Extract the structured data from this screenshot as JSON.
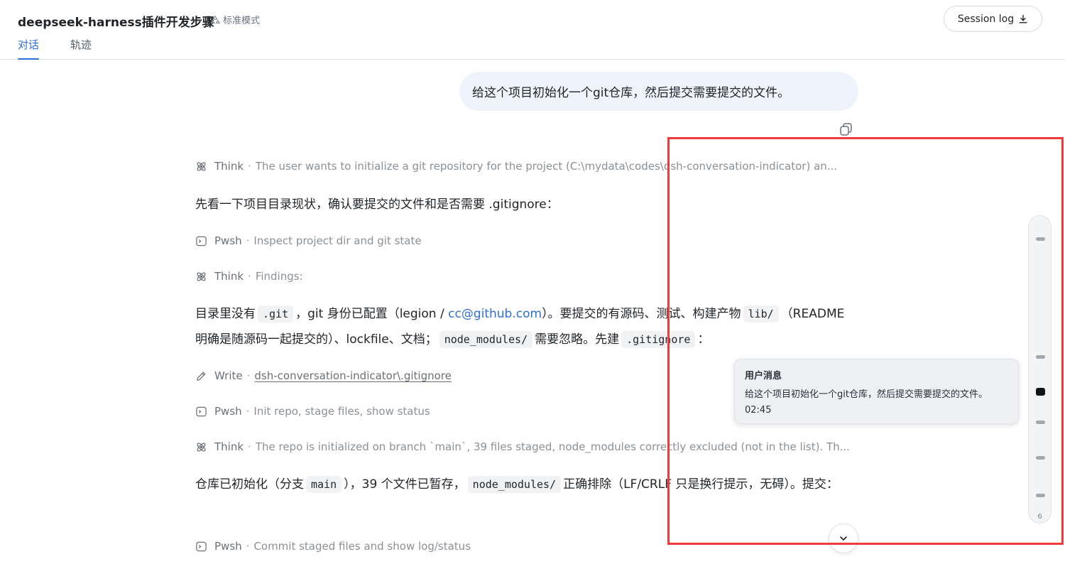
{
  "header": {
    "title": "deepseek-harness插件开发步骤",
    "mode_label": "标准模式",
    "tabs": [
      {
        "label": "对话",
        "active": true
      },
      {
        "label": "轨迹",
        "active": false
      }
    ],
    "session_log_label": "Session log"
  },
  "user_message": {
    "text": "给这个项目初始化一个git仓库，然后提交需要提交的文件。"
  },
  "steps": [
    {
      "kind": "Think",
      "icon": "atom-icon",
      "desc": "The user wants to initialize a git repository for the project (C:\\mydata\\codes\\dsh-conversation-indicator) an..."
    },
    {
      "kind": "Pwsh",
      "icon": "terminal-icon",
      "desc": "Inspect project dir and git state"
    },
    {
      "kind": "Think",
      "icon": "atom-icon",
      "desc": "Findings:"
    },
    {
      "kind": "Write",
      "icon": "pencil-icon",
      "desc": "dsh-conversation-indicator\\.gitignore"
    },
    {
      "kind": "Pwsh",
      "icon": "terminal-icon",
      "desc": "Init repo, stage files, show status"
    },
    {
      "kind": "Think",
      "icon": "atom-icon",
      "desc": "The repo is initialized on branch `main`, 39 files staged, node_modules correctly excluded (not in the list). Th..."
    },
    {
      "kind": "Pwsh",
      "icon": "terminal-icon",
      "desc": "Commit staged files and show log/status"
    }
  ],
  "paragraphs": {
    "p1": "先看一下项目目录现状，确认要提交的文件和是否需要 .gitignore：",
    "p2": {
      "t1": "目录里没有",
      "c1": ".git",
      "t2": "，git 身份已配置（legion /",
      "email": "cc@github.com",
      "t3": "）。要提交的有源码、测试、构建产物",
      "c2": "lib/",
      "t4": "（README 明确是随源码一起提交的）、lockfile、文档；",
      "c3": "node_modules/",
      "t5": "需要忽略。先建",
      "c4": ".gitignore",
      "t6": "："
    },
    "p3": {
      "t1": "仓库已初始化（分支",
      "c1": "main",
      "t2": "），39 个文件已暂存，",
      "c2": "node_modules/",
      "t3": "正确排除（LF/CRLF 只是换行提示，无碍）。提交："
    }
  },
  "indicator": {
    "count": "6",
    "active_index": 3,
    "tooltip": {
      "title": "用户消息",
      "body": "给这个项目初始化一个git仓库，然后提交需要提交的文件。02:45"
    }
  },
  "colors": {
    "accent": "#2f6fdd",
    "highlight_border": "#ef3b3b",
    "bubble_bg": "#eef3fc"
  }
}
